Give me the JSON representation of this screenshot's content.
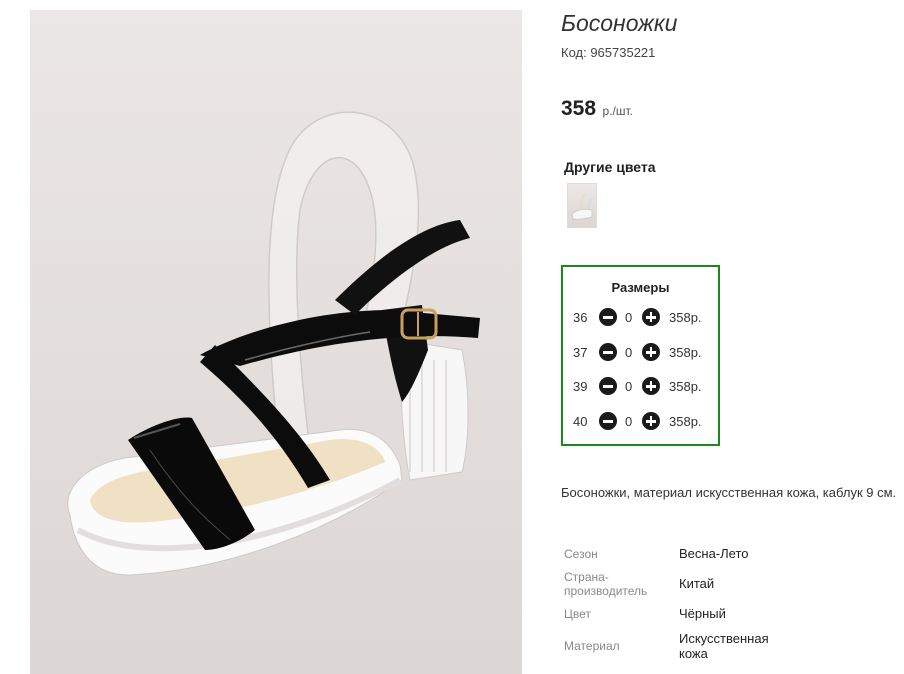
{
  "product": {
    "title": "Босоножки",
    "code": "Код: 965735221",
    "price_value": "358",
    "price_unit": "р./шт.",
    "description": "Босоножки, материал искусственная кожа, каблук 9 см."
  },
  "colors": {
    "label": "Другие цвета",
    "thumbnails": [
      "sandal-thumbnail-white"
    ]
  },
  "sizes": {
    "title": "Размеры",
    "rows": [
      {
        "size": "36",
        "qty": "0",
        "price": "358р."
      },
      {
        "size": "37",
        "qty": "0",
        "price": "358р."
      },
      {
        "size": "39",
        "qty": "0",
        "price": "358р."
      },
      {
        "size": "40",
        "qty": "0",
        "price": "358р."
      }
    ],
    "icons": {
      "decrease": "minus-circle-icon",
      "increase": "plus-circle-icon"
    },
    "accent_color": "#1a8a1a"
  },
  "specs": [
    {
      "label": "Сезон",
      "value": "Весна-Лето"
    },
    {
      "label": "Страна-производитель",
      "value": "Китай"
    },
    {
      "label": "Цвет",
      "value": "Чёрный"
    },
    {
      "label": "Материал",
      "value": "Искусственная кожа"
    }
  ]
}
